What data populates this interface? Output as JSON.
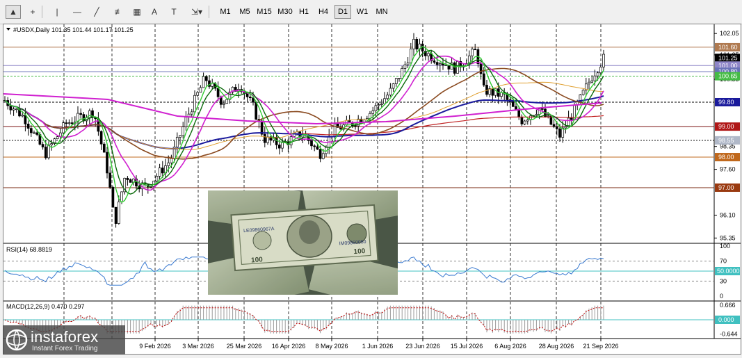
{
  "toolbar": {
    "tools": [
      {
        "name": "cursor-tool",
        "glyph": "▲"
      },
      {
        "name": "crosshair-tool",
        "glyph": "+"
      },
      {
        "name": "vertical-line-tool",
        "glyph": "|"
      },
      {
        "name": "horizontal-line-tool",
        "glyph": "—"
      },
      {
        "name": "trend-line-tool",
        "glyph": "╱"
      },
      {
        "name": "fibonacci-tool",
        "glyph": "≢"
      },
      {
        "name": "grid-tool",
        "glyph": "▦"
      },
      {
        "name": "text-tool",
        "glyph": "A"
      },
      {
        "name": "text-label-tool",
        "glyph": "T"
      },
      {
        "name": "shapes-tool",
        "glyph": "⇲▾"
      }
    ],
    "timeframes": [
      "M1",
      "M5",
      "M15",
      "M30",
      "H1",
      "H4",
      "D1",
      "W1",
      "MN"
    ],
    "active_timeframe": "D1"
  },
  "chart": {
    "header": "#USDX,Daily  101.35 101.44 101.17 101.25",
    "rsi_label": "RSI(14) 68.8819",
    "macd_label": "MACD(12,26,9) 0.470 0.297",
    "price_ticks": [
      "102.05",
      "101.35",
      "100.55",
      "98.35",
      "97.60",
      "96.10",
      "95.35"
    ],
    "price_levels": [
      {
        "label": "101.60",
        "value": 101.6,
        "bg": "#b07a50",
        "fg": "#ffffff"
      },
      {
        "label": "101.25",
        "value": 101.25,
        "bg": "#000000",
        "fg": "#ffffff"
      },
      {
        "label": "101.00",
        "value": 101.0,
        "bg": "#8f86c8",
        "fg": "#ffffff"
      },
      {
        "label": "100.80",
        "value": 100.8,
        "bg": "#6a72b8",
        "fg": "#ffffff"
      },
      {
        "label": "100.65",
        "value": 100.65,
        "bg": "#44bb44",
        "fg": "#ffffff"
      },
      {
        "label": "99.80",
        "value": 99.8,
        "bg": "#1a1a9c",
        "fg": "#ffffff"
      },
      {
        "label": "99.00",
        "value": 99.0,
        "bg": "#b01818",
        "fg": "#ffffff"
      },
      {
        "label": "98.55",
        "value": 98.55,
        "bg": "#b0b8c8",
        "fg": "#ffffff"
      },
      {
        "label": "98.00",
        "value": 98.0,
        "bg": "#c0681c",
        "fg": "#ffffff"
      },
      {
        "label": "97.00",
        "value": 97.0,
        "bg": "#9a3a10",
        "fg": "#ffffff"
      }
    ],
    "rsi_ticks": [
      "100",
      "70",
      "50.0000",
      "30",
      "0"
    ],
    "macd_ticks": [
      "0.666",
      "0.000",
      "-0.644"
    ],
    "dates": [
      "9 Feb 2026",
      "3 Mar 2026",
      "25 Mar 2026",
      "16 Apr 2026",
      "8 May 2026",
      "1 Jun 2026",
      "23 Jun 2026",
      "15 Jul 2026",
      "6 Aug 2026",
      "28 Aug 2026",
      "21 Sep 2026"
    ]
  },
  "logo": {
    "brand": "instaforex",
    "tagline": "Instant Forex Trading"
  },
  "colors": {
    "ma_magenta": "#d020d0",
    "ma_blue": "#1a1a9c",
    "ma_green": "#22a022",
    "ma_dark_green": "#0a6a0a",
    "ma_brown": "#8a4a20",
    "ma_orange": "#e0a030",
    "ma_red": "#c02020",
    "rsi_line": "#3a7ad0",
    "macd_signal": "#c00000",
    "level_cyan": "#40c0c0"
  }
}
